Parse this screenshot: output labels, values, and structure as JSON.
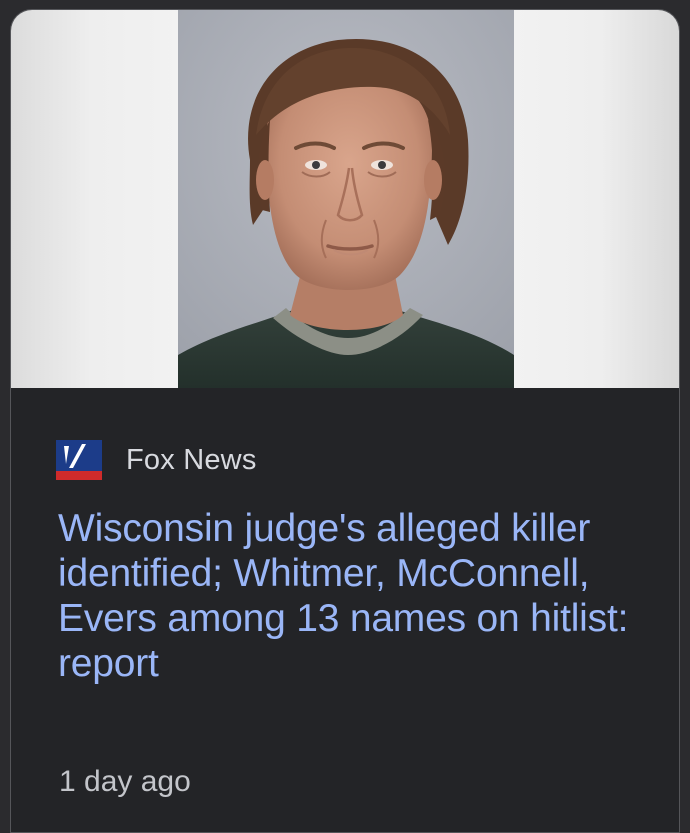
{
  "card": {
    "source_name": "Fox News",
    "source_logo_icon": "fox-news-logo-icon",
    "headline": "Wisconsin judge's alleged killer identified; Whitmer, McConnell, Evers among 13 names on hitlist: report",
    "timestamp": "1 day ago"
  },
  "colors": {
    "background": "#232427",
    "headline": "#9ab6f7",
    "source_text": "#d8dadf",
    "timestamp": "#c3c5ca",
    "logo_blue": "#1c3c89",
    "logo_red": "#cf2b2b"
  }
}
